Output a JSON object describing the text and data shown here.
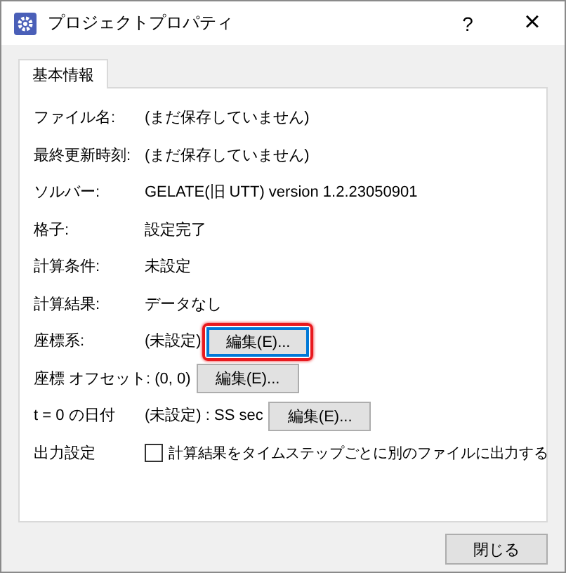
{
  "window": {
    "title": "プロジェクトプロパティ",
    "help": "?",
    "close": "×"
  },
  "tabs": [
    {
      "label": "基本情報",
      "selected": true
    }
  ],
  "rows": [
    {
      "kind": "text",
      "label": "ファイル名:",
      "value": "(まだ保存していません)"
    },
    {
      "kind": "text",
      "label": "最終更新時刻:",
      "value": "(まだ保存していません)"
    },
    {
      "kind": "text",
      "label": "ソルバー:",
      "value": "GELATE(旧 UTT) version 1.2.23050901"
    },
    {
      "kind": "text",
      "label": "格子:",
      "value": "設定完了"
    },
    {
      "kind": "text",
      "label": "計算条件:",
      "value": "未設定"
    },
    {
      "kind": "text",
      "label": "計算結果:",
      "value": "データなし"
    },
    {
      "kind": "button",
      "label": "座標系:",
      "value": "(未設定)",
      "button": "編集(E)...",
      "focused": true,
      "highlighted": true
    },
    {
      "kind": "button",
      "label": "座標 オフセット:",
      "value": "(0, 0)",
      "button": "編集(E)...",
      "focused": false,
      "highlighted": false
    },
    {
      "kind": "button",
      "label": "t = 0 の日付",
      "value": "(未設定) : SS sec",
      "button": "編集(E)...",
      "focused": false,
      "highlighted": false
    },
    {
      "kind": "checkbox",
      "label": "出力設定",
      "value": "計算結果をタイムステップごとに別のファイルに出力する",
      "checked": false
    }
  ],
  "buttons": [
    "閉じる"
  ]
}
